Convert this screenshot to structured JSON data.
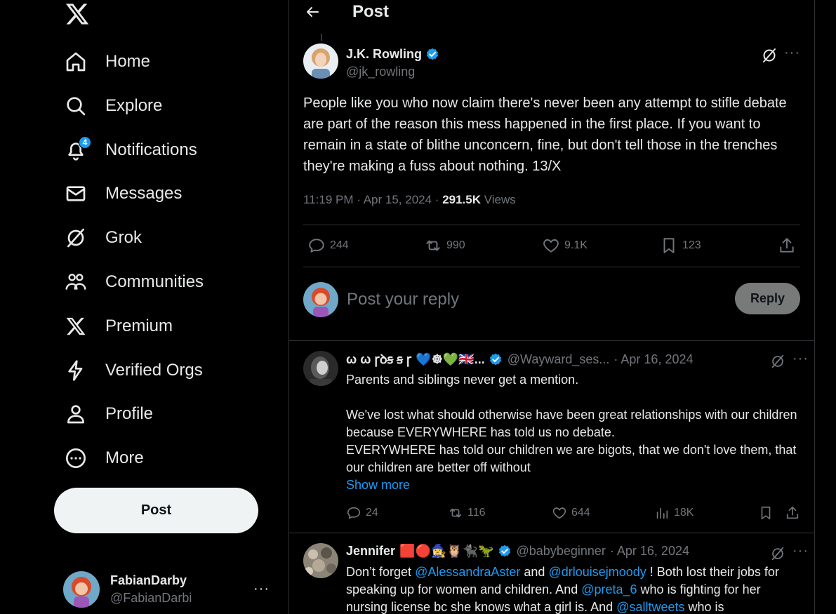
{
  "sidebar": {
    "logo_icon": "x-logo-icon",
    "nav": [
      {
        "key": "home",
        "label": "Home",
        "icon": "home-icon"
      },
      {
        "key": "explore",
        "label": "Explore",
        "icon": "search-icon"
      },
      {
        "key": "notifications",
        "label": "Notifications",
        "icon": "bell-icon",
        "badge": "4"
      },
      {
        "key": "messages",
        "label": "Messages",
        "icon": "envelope-icon"
      },
      {
        "key": "grok",
        "label": "Grok",
        "icon": "grok-icon"
      },
      {
        "key": "communities",
        "label": "Communities",
        "icon": "people-icon"
      },
      {
        "key": "premium",
        "label": "Premium",
        "icon": "x-logo-icon"
      },
      {
        "key": "verified_orgs",
        "label": "Verified Orgs",
        "icon": "lightning-icon"
      },
      {
        "key": "profile",
        "label": "Profile",
        "icon": "person-icon"
      },
      {
        "key": "more",
        "label": "More",
        "icon": "more-circle-icon"
      }
    ],
    "post_button": "Post",
    "account": {
      "display_name": "FabianDarby",
      "handle": "@FabianDarbi",
      "more": "···"
    }
  },
  "header": {
    "title": "Post",
    "back_icon": "arrow-left-icon"
  },
  "main_post": {
    "author": "J.K. Rowling",
    "handle": "@jk_rowling",
    "text": "People like you who now claim there's never been any attempt to stifle debate are part of the reason this mess happened in the first place. If you want to remain in a state of blithe unconcern, fine, but don't tell those in the trenches they're making a fuss about nothing. 13/X",
    "time": "11:19 PM",
    "date": "Apr 15, 2024",
    "views_count": "291.5K",
    "views_label": "Views",
    "stats": {
      "replies": "244",
      "reposts": "990",
      "likes": "9.1K",
      "bookmarks": "123"
    },
    "more": "···"
  },
  "reply_box": {
    "placeholder": "Post your reply",
    "button": "Reply"
  },
  "replies": [
    {
      "author": "ω  ω ꞅꝺꞩ ꞩ ꞅ",
      "emoji": "💙☸💚🇬🇧...",
      "handle": "@Wayward_ses...",
      "date": "· Apr 16, 2024",
      "more": "···",
      "lines": [
        "Parents and siblings never get a mention.",
        "",
        "We've lost what should otherwise have been great relationships with our children because EVERYWHERE has told us no debate.",
        "EVERYWHERE has told our children we are bigots, that we don't love them, that our children are better off without"
      ],
      "show_more": "Show more",
      "stats": {
        "replies": "24",
        "reposts": "116",
        "likes": "644",
        "views": "18K"
      }
    },
    {
      "author": "Jennifer",
      "emoji": "🟥🔴🧙‍♀️🦉🐈‍⬛🦖",
      "handle": "@babybeginner",
      "date": "· Apr 16, 2024",
      "more": "···",
      "segments": [
        {
          "t": "Don’t forget ",
          "link": false
        },
        {
          "t": "@AlessandraAster",
          "link": true
        },
        {
          "t": " and ",
          "link": false
        },
        {
          "t": "@drlouisejmoody",
          "link": true
        },
        {
          "t": " !   Both lost their jobs for speaking up for women and children.  And ",
          "link": false
        },
        {
          "t": "@preta_6",
          "link": true
        },
        {
          "t": " who is fighting for her nursing license bc she knows what a girl is.  And ",
          "link": false
        },
        {
          "t": "@salltweets",
          "link": true
        },
        {
          "t": " who is",
          "link": false
        }
      ]
    }
  ],
  "colors": {
    "background": "#000000",
    "text": "#e7e9ea",
    "muted": "#71767b",
    "accent": "#1d9bf0",
    "border": "#2f3336"
  }
}
